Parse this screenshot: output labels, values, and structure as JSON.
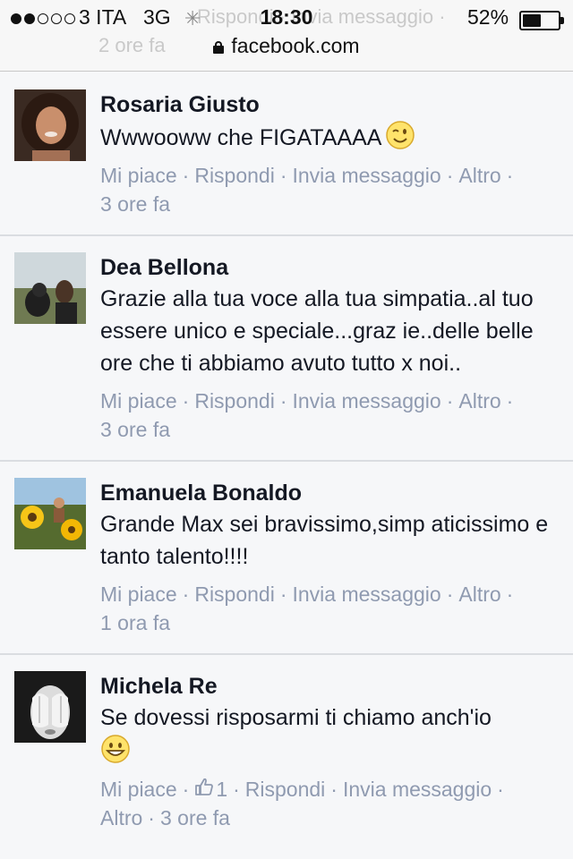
{
  "status_bar": {
    "signal_filled": 2,
    "signal_total": 5,
    "carrier": "3 ITA",
    "network": "3G",
    "time": "18:30",
    "battery_percent_label": "52%",
    "battery_level": 0.52
  },
  "address_bar": {
    "url": "facebook.com"
  },
  "ghost_row": {
    "actions": "Rispondi · Invia messaggio ·",
    "time": "2 ore fa"
  },
  "comments": [
    {
      "author": "Rosaria Giusto",
      "text": "Wwwooww che FIGATAAAA",
      "emoji": "wink-emoji",
      "actions": {
        "like": "Mi piace",
        "reply": "Rispondi",
        "message": "Invia messaggio",
        "more": "Altro"
      },
      "time": "3 ore fa"
    },
    {
      "author": "Dea Bellona",
      "text": "Grazie alla tua voce alla tua simpatia..al tuo essere unico e speciale...graz ie..delle belle ore che ti abbiamo avuto tutto x noi..",
      "actions": {
        "like": "Mi piace",
        "reply": "Rispondi",
        "message": "Invia messaggio",
        "more": "Altro"
      },
      "time": "3 ore fa"
    },
    {
      "author": "Emanuela Bonaldo",
      "text": "Grande Max sei bravissimo,simp aticissimo e tanto talento!!!!",
      "actions": {
        "like": "Mi piace",
        "reply": "Rispondi",
        "message": "Invia messaggio",
        "more": "Altro"
      },
      "time": "1 ora fa"
    },
    {
      "author": "Michela Re",
      "text": "Se dovessi risposarmi ti chiamo anch'io",
      "emoji": "grin-emoji",
      "actions": {
        "like": "Mi piace",
        "reply": "Rispondi",
        "message": "Invia messaggio",
        "more": "Altro"
      },
      "like_count": "1",
      "time": "3 ore fa"
    }
  ]
}
